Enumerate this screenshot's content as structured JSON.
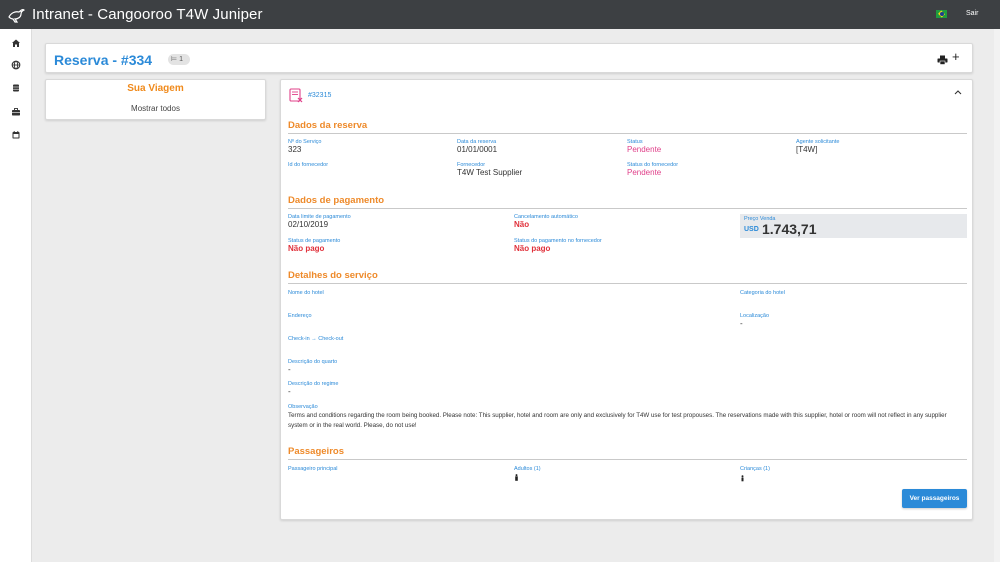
{
  "app": {
    "title": "Intranet - Cangooroo T4W Juniper",
    "exit_label": "Sair",
    "language_flag": "brazil-flag-icon"
  },
  "rail": {
    "icons": [
      "home-icon",
      "globe-icon",
      "database-icon",
      "briefcase-icon",
      "calendar-icon"
    ]
  },
  "header": {
    "title": "Reserva - #334",
    "bed_count": "1",
    "print_icon": "printer-icon",
    "add_label": "+"
  },
  "trip": {
    "title": "Sua Viagem",
    "show_all": "Mostrar todos"
  },
  "service": {
    "id": "#32315",
    "booking": {
      "section_title": "Dados da reserva",
      "service_no_label": "Nº do Serviço",
      "service_no": "323",
      "date_label": "Data da reserva",
      "date": "01/01/0001",
      "status_label": "Status",
      "status": "Pendente",
      "agent_label": "Agente solicitante",
      "agent": "[T4W]",
      "supplier_id_label": "Id do fornecedor",
      "supplier_id": "",
      "supplier_label": "Fornecedor",
      "supplier": "T4W Test Supplier",
      "supplier_status_label": "Status do fornecedor",
      "supplier_status": "Pendente"
    },
    "payment": {
      "section_title": "Dados de pagamento",
      "deadline_label": "Data limite de pagamento",
      "deadline": "02/10/2019",
      "auto_cancel_label": "Cancelamento automático",
      "auto_cancel": "Não",
      "price_label": "Preço Venda",
      "price_currency": "USD",
      "price_value": "1.743,71",
      "pay_status_label": "Status de pagamento",
      "pay_status": "Não pago",
      "supplier_pay_status_label": "Status do pagamento no fornecedor",
      "supplier_pay_status": "Não pago"
    },
    "details": {
      "section_title": "Detalhes do serviço",
      "hotel_name_label": "Nome do hotel",
      "hotel_name": "",
      "hotel_category_label": "Categoria do hotel",
      "hotel_category": "",
      "address_label": "Endereço",
      "address": "",
      "location_label": "Localização",
      "location": "-",
      "checkin_label": "Check-in → Check-out",
      "checkin": "",
      "room_desc_label": "Descrição do quarto",
      "room_desc": "-",
      "regime_desc_label": "Descrição do regime",
      "regime_desc": "-",
      "observation_label": "Observação",
      "observation": "Terms and conditions regarding the room being booked. Please note: This supplier, hotel and room are only and exclusively for T4W use for test propouses. The reservations made with this supplier, hotel or room will not reflect in any supplier system or in the real world. Please, do not use!"
    },
    "passengers": {
      "section_title": "Passageiros",
      "main_label": "Passageiro principal",
      "adults_label": "Adultos (1)",
      "children_label": "Crianças (1)",
      "button_label": "Ver passageiros"
    }
  },
  "colors": {
    "topbar": "#3d4043",
    "accent_blue": "#2b8ad8",
    "orange": "#ee8a2a",
    "pink": "#e0408a",
    "red": "#e0303a"
  }
}
